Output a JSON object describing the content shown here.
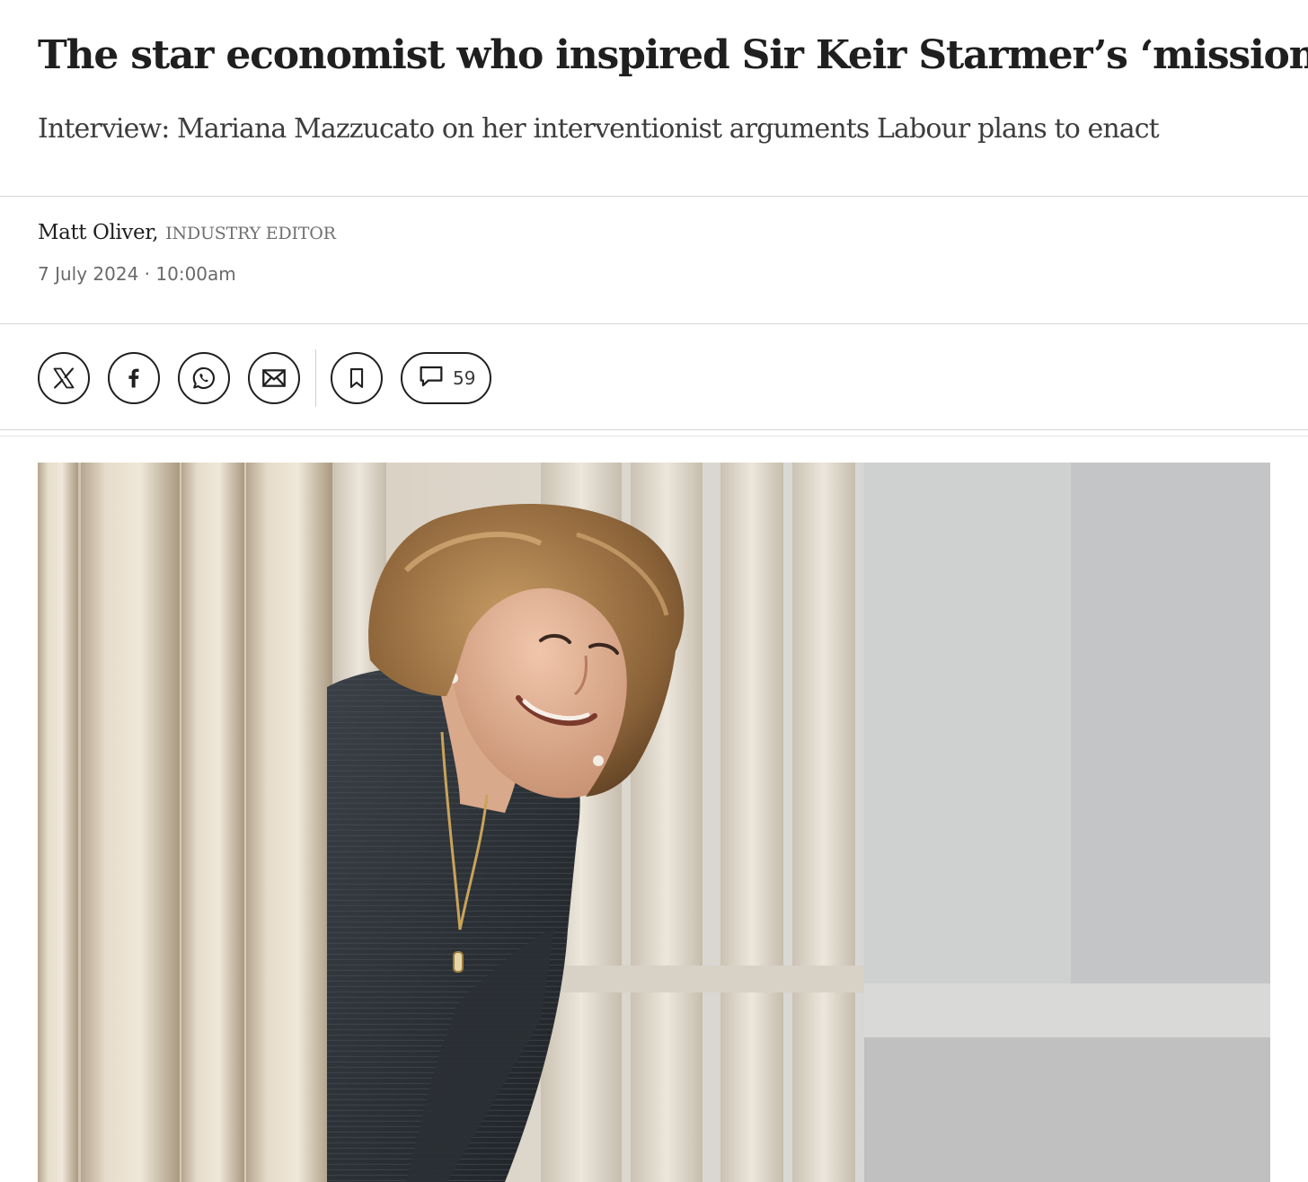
{
  "article": {
    "headline": "The star economist who inspired Sir Keir Starmer’s ‘missions’",
    "standfirst": "Interview: Mariana Mazzucato on her interventionist arguments Labour plans to enact",
    "author": "Matt Oliver,",
    "author_role": "INDUSTRY EDITOR",
    "date": "7 July 2024",
    "separator": "·",
    "time": "10:00am"
  },
  "share": {
    "buttons": [
      {
        "icon": "x-icon"
      },
      {
        "icon": "facebook-icon"
      },
      {
        "icon": "whatsapp-icon"
      },
      {
        "icon": "email-icon"
      },
      {
        "icon": "bookmark-icon"
      }
    ],
    "comments": {
      "icon": "comment-icon",
      "count": "59"
    }
  },
  "colors": {
    "text": "#1f1f1f",
    "muted": "#6a6a6a",
    "rule": "#d6d6d6"
  }
}
